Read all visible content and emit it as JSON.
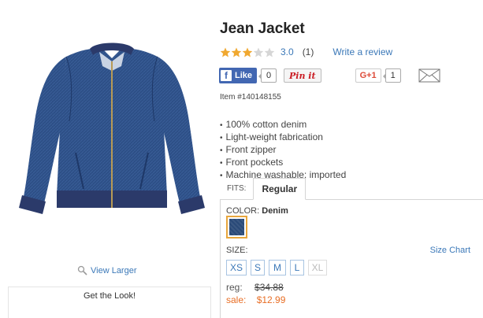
{
  "product": {
    "title": "Jean Jacket",
    "rating": "3.0",
    "rating_stars": 3,
    "rating_max": 5,
    "review_count": "(1)",
    "write_review": "Write a review",
    "item_number": "Item #140148155",
    "features": [
      "100% cotton denim",
      "Light-weight fabrication",
      "Front zipper",
      "Front pockets",
      "Machine washable; imported"
    ]
  },
  "image": {
    "view_larger": "View Larger",
    "get_the_look": "Get the Look!"
  },
  "social": {
    "fb_letter": "f",
    "fb_like": "Like",
    "fb_count": "0",
    "pinit": "Pin it",
    "gplus": "G+1",
    "gplus_count": "1"
  },
  "fits": {
    "label": "FITS:",
    "tab": "Regular"
  },
  "options": {
    "color_label": "COLOR:",
    "color_value": "Denim",
    "size_label": "SIZE:",
    "size_chart": "Size Chart",
    "sizes": [
      "XS",
      "S",
      "M",
      "L",
      "XL"
    ],
    "unavailable_sizes": [
      "XL"
    ]
  },
  "pricing": {
    "reg_label": "reg:",
    "reg_value": "$34.88",
    "sale_label": "sale:",
    "sale_value": "$12.99"
  },
  "colors": {
    "link": "#3b78b8",
    "sale": "#e86e25",
    "star": "#f0a830",
    "swatch_border": "#e8a63d",
    "facebook": "#4267b2"
  }
}
